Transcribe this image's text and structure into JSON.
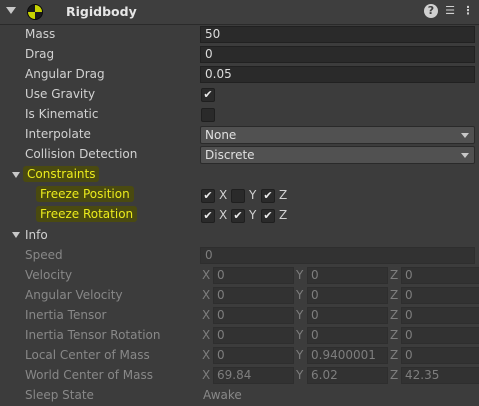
{
  "header": {
    "title": "Rigidbody",
    "icons": [
      "fold-arrow-icon",
      "rigidbody-icon",
      "help-icon",
      "sliders-icon",
      "more-icon"
    ]
  },
  "fields": {
    "mass": {
      "label": "Mass",
      "value": "50"
    },
    "drag": {
      "label": "Drag",
      "value": "0"
    },
    "angular_drag": {
      "label": "Angular Drag",
      "value": "0.05"
    },
    "use_gravity": {
      "label": "Use Gravity",
      "checked": true
    },
    "is_kinematic": {
      "label": "Is Kinematic",
      "checked": false
    },
    "interpolate": {
      "label": "Interpolate",
      "value": "None"
    },
    "collision_detection": {
      "label": "Collision Detection",
      "value": "Discrete"
    }
  },
  "constraints": {
    "label": "Constraints",
    "freeze_position": {
      "label": "Freeze Position",
      "x": true,
      "y": false,
      "z": true
    },
    "freeze_rotation": {
      "label": "Freeze Rotation",
      "x": true,
      "y": true,
      "z": true
    },
    "axes": {
      "x": "X",
      "y": "Y",
      "z": "Z"
    }
  },
  "info": {
    "label": "Info",
    "speed": {
      "label": "Speed",
      "value": "0"
    },
    "velocity": {
      "label": "Velocity",
      "x": "0",
      "y": "0",
      "z": "0"
    },
    "angular_velocity": {
      "label": "Angular Velocity",
      "x": "0",
      "y": "0",
      "z": "0"
    },
    "inertia_tensor": {
      "label": "Inertia Tensor",
      "x": "0",
      "y": "0",
      "z": "0"
    },
    "inertia_tensor_rotation": {
      "label": "Inertia Tensor Rotation",
      "x": "0",
      "y": "0",
      "z": "0"
    },
    "local_center_of_mass": {
      "label": "Local Center of Mass",
      "x": "0",
      "y": "0.9400001",
      "z": "0"
    },
    "world_center_of_mass": {
      "label": "World Center of Mass",
      "x": "69.84",
      "y": "6.02",
      "z": "42.35"
    },
    "sleep_state": {
      "label": "Sleep State",
      "value": "Awake"
    }
  },
  "colors": {
    "highlight": "#ecec1c",
    "background": "#3c3c3c"
  }
}
